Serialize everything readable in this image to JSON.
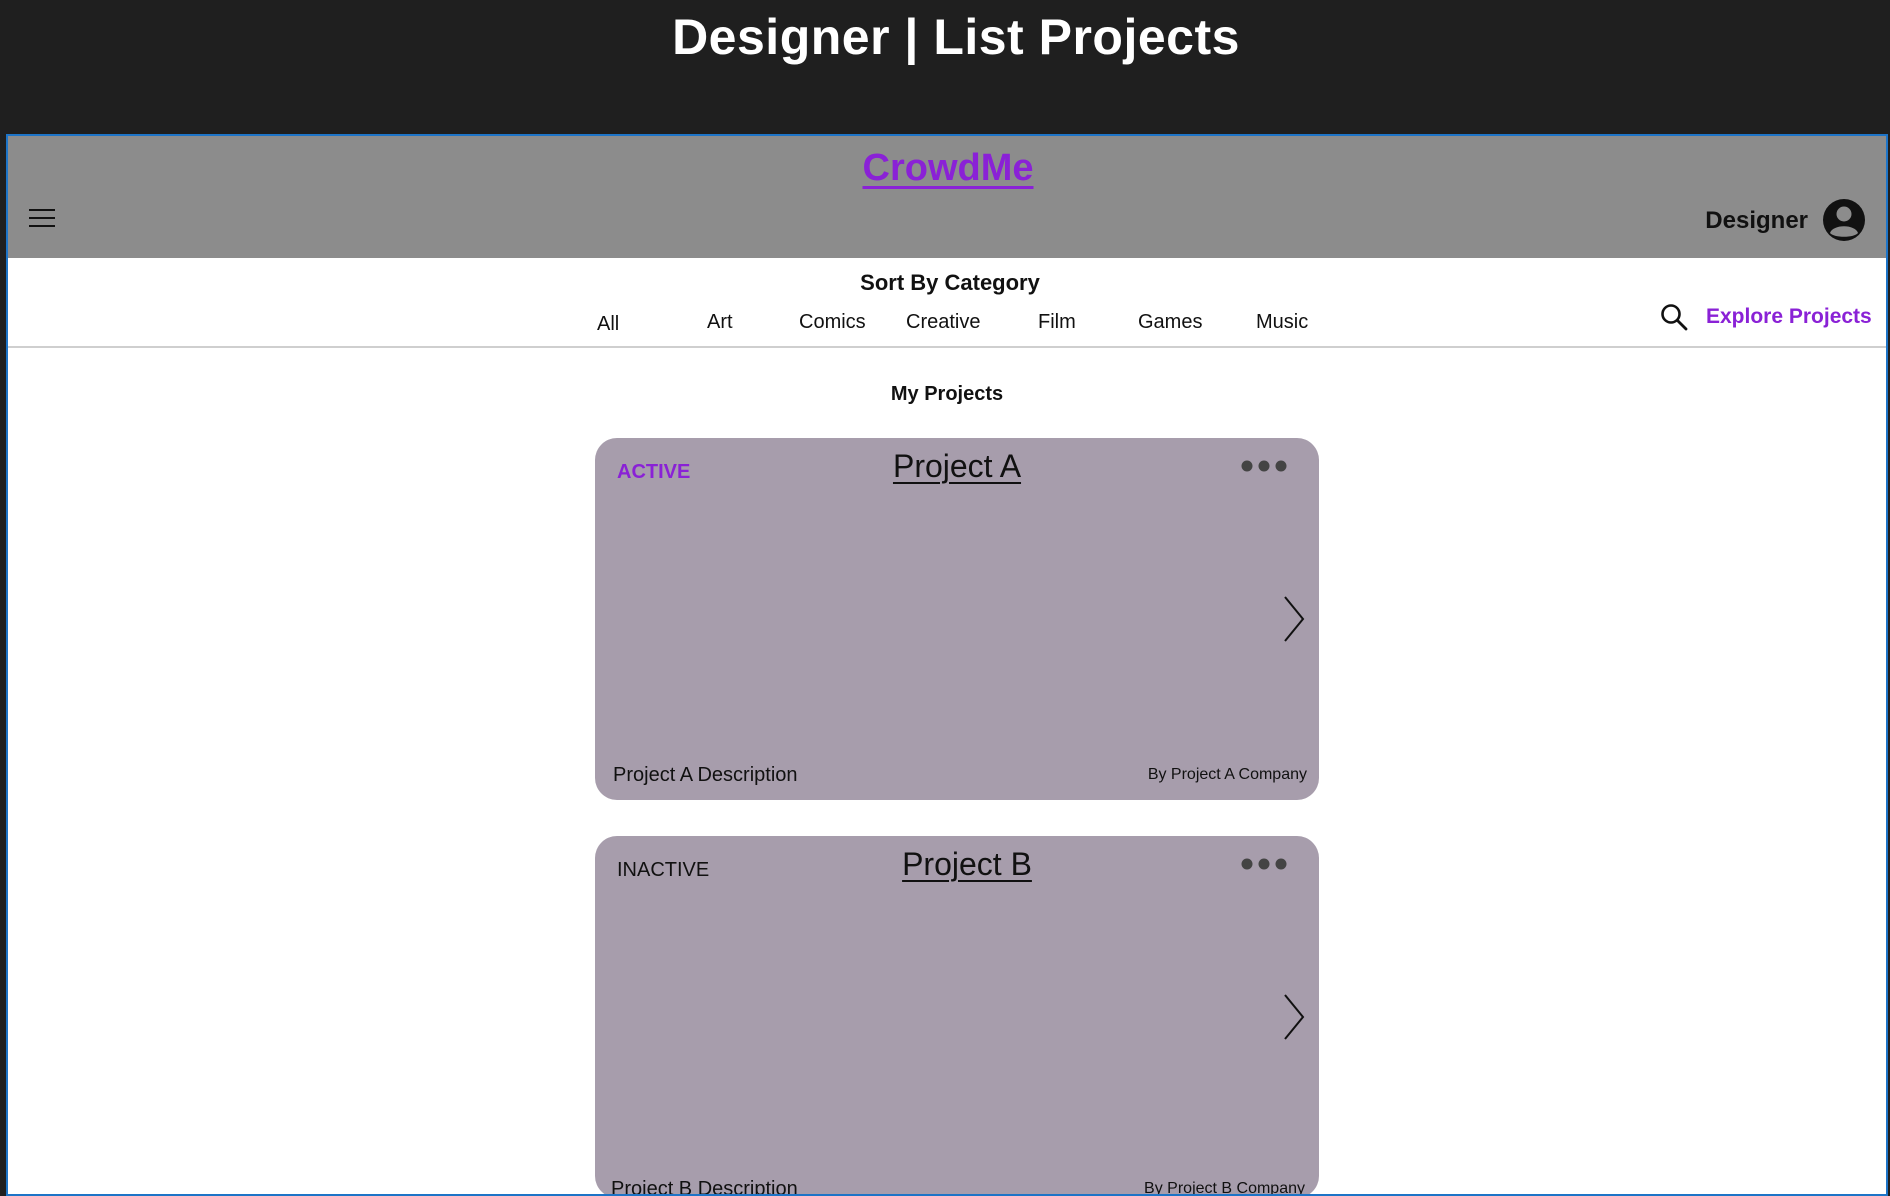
{
  "banner": {
    "title": "Designer | List Projects"
  },
  "header": {
    "brand": "CrowdMe",
    "role": "Designer",
    "menu_icon": "hamburger-menu-icon",
    "avatar_icon": "user-circle-icon"
  },
  "categories": {
    "title": "Sort By Category",
    "items": [
      "All",
      "Art",
      "Comics",
      "Creative",
      "Film",
      "Games",
      "Music"
    ]
  },
  "explore": {
    "label": "Explore Projects",
    "icon": "search-icon"
  },
  "main": {
    "section_title": "My Projects",
    "projects": [
      {
        "status": "ACTIVE",
        "title": "Project A",
        "description": "Project A Description",
        "company": "By Project A Company"
      },
      {
        "status": "INACTIVE",
        "title": "Project B",
        "description": "Project B Description",
        "company": "By Project B Company"
      }
    ]
  },
  "colors": {
    "accent": "#8a21d6",
    "header_bg": "#8c8c8c",
    "card_bg": "#a79dac",
    "banner_bg": "#1f1f1f",
    "frame_border": "#1d74c7"
  }
}
